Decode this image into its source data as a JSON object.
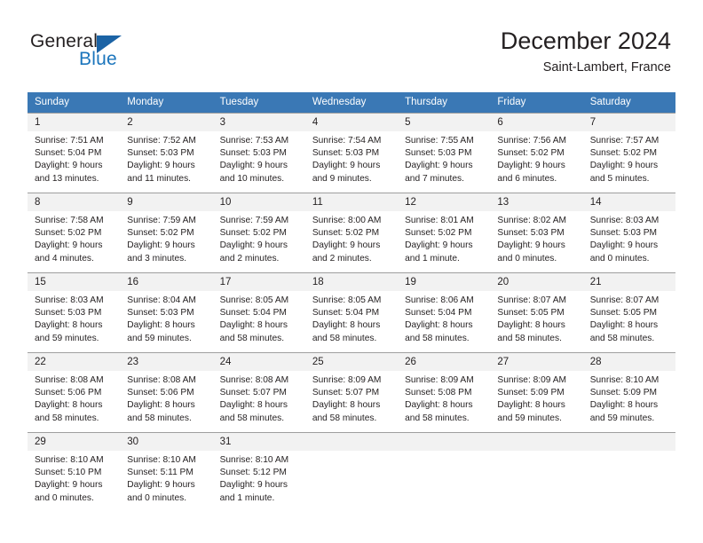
{
  "brand": {
    "name_top": "General",
    "name_bottom": "Blue",
    "triangle_color": "#1b63a5",
    "blue_color": "#1b75bc"
  },
  "header": {
    "title": "December 2024",
    "subtitle": "Saint-Lambert, France",
    "header_bg": "#3a78b5",
    "daynum_bg": "#f2f2f2"
  },
  "weekdays": [
    "Sunday",
    "Monday",
    "Tuesday",
    "Wednesday",
    "Thursday",
    "Friday",
    "Saturday"
  ],
  "weeks": [
    [
      {
        "day": "1",
        "sunrise": "Sunrise: 7:51 AM",
        "sunset": "Sunset: 5:04 PM",
        "daylight1": "Daylight: 9 hours",
        "daylight2": "and 13 minutes."
      },
      {
        "day": "2",
        "sunrise": "Sunrise: 7:52 AM",
        "sunset": "Sunset: 5:03 PM",
        "daylight1": "Daylight: 9 hours",
        "daylight2": "and 11 minutes."
      },
      {
        "day": "3",
        "sunrise": "Sunrise: 7:53 AM",
        "sunset": "Sunset: 5:03 PM",
        "daylight1": "Daylight: 9 hours",
        "daylight2": "and 10 minutes."
      },
      {
        "day": "4",
        "sunrise": "Sunrise: 7:54 AM",
        "sunset": "Sunset: 5:03 PM",
        "daylight1": "Daylight: 9 hours",
        "daylight2": "and 9 minutes."
      },
      {
        "day": "5",
        "sunrise": "Sunrise: 7:55 AM",
        "sunset": "Sunset: 5:03 PM",
        "daylight1": "Daylight: 9 hours",
        "daylight2": "and 7 minutes."
      },
      {
        "day": "6",
        "sunrise": "Sunrise: 7:56 AM",
        "sunset": "Sunset: 5:02 PM",
        "daylight1": "Daylight: 9 hours",
        "daylight2": "and 6 minutes."
      },
      {
        "day": "7",
        "sunrise": "Sunrise: 7:57 AM",
        "sunset": "Sunset: 5:02 PM",
        "daylight1": "Daylight: 9 hours",
        "daylight2": "and 5 minutes."
      }
    ],
    [
      {
        "day": "8",
        "sunrise": "Sunrise: 7:58 AM",
        "sunset": "Sunset: 5:02 PM",
        "daylight1": "Daylight: 9 hours",
        "daylight2": "and 4 minutes."
      },
      {
        "day": "9",
        "sunrise": "Sunrise: 7:59 AM",
        "sunset": "Sunset: 5:02 PM",
        "daylight1": "Daylight: 9 hours",
        "daylight2": "and 3 minutes."
      },
      {
        "day": "10",
        "sunrise": "Sunrise: 7:59 AM",
        "sunset": "Sunset: 5:02 PM",
        "daylight1": "Daylight: 9 hours",
        "daylight2": "and 2 minutes."
      },
      {
        "day": "11",
        "sunrise": "Sunrise: 8:00 AM",
        "sunset": "Sunset: 5:02 PM",
        "daylight1": "Daylight: 9 hours",
        "daylight2": "and 2 minutes."
      },
      {
        "day": "12",
        "sunrise": "Sunrise: 8:01 AM",
        "sunset": "Sunset: 5:02 PM",
        "daylight1": "Daylight: 9 hours",
        "daylight2": "and 1 minute."
      },
      {
        "day": "13",
        "sunrise": "Sunrise: 8:02 AM",
        "sunset": "Sunset: 5:03 PM",
        "daylight1": "Daylight: 9 hours",
        "daylight2": "and 0 minutes."
      },
      {
        "day": "14",
        "sunrise": "Sunrise: 8:03 AM",
        "sunset": "Sunset: 5:03 PM",
        "daylight1": "Daylight: 9 hours",
        "daylight2": "and 0 minutes."
      }
    ],
    [
      {
        "day": "15",
        "sunrise": "Sunrise: 8:03 AM",
        "sunset": "Sunset: 5:03 PM",
        "daylight1": "Daylight: 8 hours",
        "daylight2": "and 59 minutes."
      },
      {
        "day": "16",
        "sunrise": "Sunrise: 8:04 AM",
        "sunset": "Sunset: 5:03 PM",
        "daylight1": "Daylight: 8 hours",
        "daylight2": "and 59 minutes."
      },
      {
        "day": "17",
        "sunrise": "Sunrise: 8:05 AM",
        "sunset": "Sunset: 5:04 PM",
        "daylight1": "Daylight: 8 hours",
        "daylight2": "and 58 minutes."
      },
      {
        "day": "18",
        "sunrise": "Sunrise: 8:05 AM",
        "sunset": "Sunset: 5:04 PM",
        "daylight1": "Daylight: 8 hours",
        "daylight2": "and 58 minutes."
      },
      {
        "day": "19",
        "sunrise": "Sunrise: 8:06 AM",
        "sunset": "Sunset: 5:04 PM",
        "daylight1": "Daylight: 8 hours",
        "daylight2": "and 58 minutes."
      },
      {
        "day": "20",
        "sunrise": "Sunrise: 8:07 AM",
        "sunset": "Sunset: 5:05 PM",
        "daylight1": "Daylight: 8 hours",
        "daylight2": "and 58 minutes."
      },
      {
        "day": "21",
        "sunrise": "Sunrise: 8:07 AM",
        "sunset": "Sunset: 5:05 PM",
        "daylight1": "Daylight: 8 hours",
        "daylight2": "and 58 minutes."
      }
    ],
    [
      {
        "day": "22",
        "sunrise": "Sunrise: 8:08 AM",
        "sunset": "Sunset: 5:06 PM",
        "daylight1": "Daylight: 8 hours",
        "daylight2": "and 58 minutes."
      },
      {
        "day": "23",
        "sunrise": "Sunrise: 8:08 AM",
        "sunset": "Sunset: 5:06 PM",
        "daylight1": "Daylight: 8 hours",
        "daylight2": "and 58 minutes."
      },
      {
        "day": "24",
        "sunrise": "Sunrise: 8:08 AM",
        "sunset": "Sunset: 5:07 PM",
        "daylight1": "Daylight: 8 hours",
        "daylight2": "and 58 minutes."
      },
      {
        "day": "25",
        "sunrise": "Sunrise: 8:09 AM",
        "sunset": "Sunset: 5:07 PM",
        "daylight1": "Daylight: 8 hours",
        "daylight2": "and 58 minutes."
      },
      {
        "day": "26",
        "sunrise": "Sunrise: 8:09 AM",
        "sunset": "Sunset: 5:08 PM",
        "daylight1": "Daylight: 8 hours",
        "daylight2": "and 58 minutes."
      },
      {
        "day": "27",
        "sunrise": "Sunrise: 8:09 AM",
        "sunset": "Sunset: 5:09 PM",
        "daylight1": "Daylight: 8 hours",
        "daylight2": "and 59 minutes."
      },
      {
        "day": "28",
        "sunrise": "Sunrise: 8:10 AM",
        "sunset": "Sunset: 5:09 PM",
        "daylight1": "Daylight: 8 hours",
        "daylight2": "and 59 minutes."
      }
    ],
    [
      {
        "day": "29",
        "sunrise": "Sunrise: 8:10 AM",
        "sunset": "Sunset: 5:10 PM",
        "daylight1": "Daylight: 9 hours",
        "daylight2": "and 0 minutes."
      },
      {
        "day": "30",
        "sunrise": "Sunrise: 8:10 AM",
        "sunset": "Sunset: 5:11 PM",
        "daylight1": "Daylight: 9 hours",
        "daylight2": "and 0 minutes."
      },
      {
        "day": "31",
        "sunrise": "Sunrise: 8:10 AM",
        "sunset": "Sunset: 5:12 PM",
        "daylight1": "Daylight: 9 hours",
        "daylight2": "and 1 minute."
      },
      {
        "day": "",
        "sunrise": "",
        "sunset": "",
        "daylight1": "",
        "daylight2": ""
      },
      {
        "day": "",
        "sunrise": "",
        "sunset": "",
        "daylight1": "",
        "daylight2": ""
      },
      {
        "day": "",
        "sunrise": "",
        "sunset": "",
        "daylight1": "",
        "daylight2": ""
      },
      {
        "day": "",
        "sunrise": "",
        "sunset": "",
        "daylight1": "",
        "daylight2": ""
      }
    ]
  ]
}
